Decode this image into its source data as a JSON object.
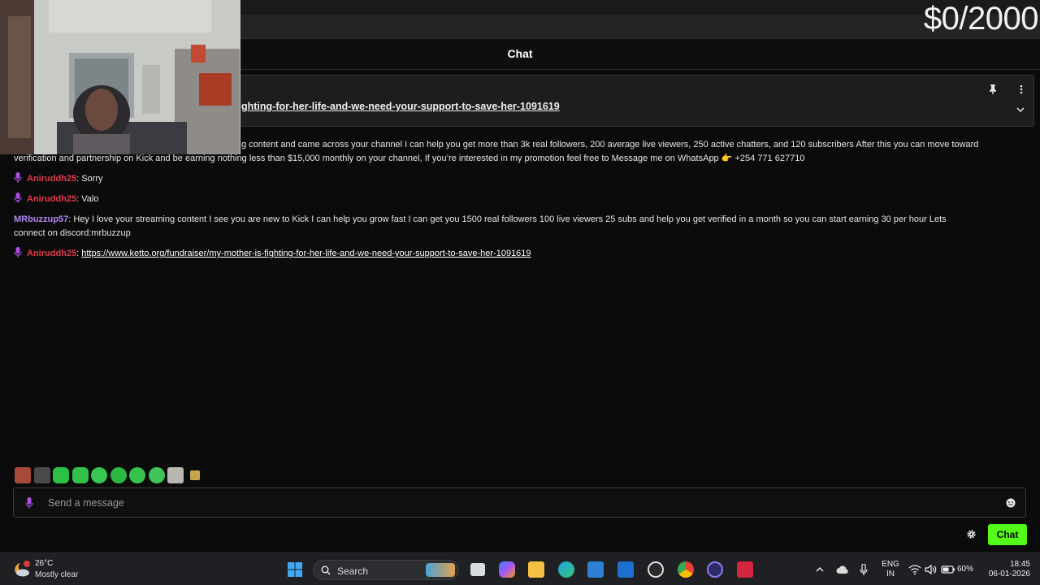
{
  "goal_text": "$0/2000",
  "chat": {
    "title": "Chat",
    "pinned_link": "ghting-for-her-life-and-we-need-your-support-to-save-her-1091619",
    "messages": [
      {
        "text_line1": "g content and came across your channel I can help you get more than 3k real followers, 200 average live viewers, 250 active chatters, and 120 subscribers After this you can move toward",
        "text_line2": "verification and partnership on Kick and be earning nothing less than $15,000 monthly on your channel, If you’re interested in my promotion feel free to Message me on WhatsApp 👉 +254 771 627710"
      },
      {
        "user": "Aniruddh25",
        "text": ": Sorry"
      },
      {
        "user": "Aniruddh25",
        "text": ": Valo"
      },
      {
        "user": "MRbuzzup57",
        "text_line1": ": Hey I love your streaming content I see you are new to Kick I can help you grow fast I can get you 1500 real followers 100 live viewers 25 subs and help you get verified in a month so you can start earning 30 per hour Lets",
        "text_line2": "connect on discord:mrbuzzup"
      },
      {
        "user": "Aniruddh25",
        "separator": ": ",
        "link": "https://www.ketto.org/fundraiser/my-mother-is-fighting-for-her-life-and-we-need-your-support-to-save-her-1091619"
      }
    ],
    "input_placeholder": "Send a message",
    "send_label": "Chat"
  },
  "taskbar": {
    "weather_temp": "26°C",
    "weather_desc": "Mostly clear",
    "search_label": "Search",
    "lang_line1": "ENG",
    "lang_line2": "IN",
    "battery": "60%",
    "time": "18:45",
    "date": "06-01-2026"
  },
  "colors": {
    "accent_green": "#53fc18",
    "user_pink": "#e23a4c",
    "user_purple": "#b486f0"
  }
}
